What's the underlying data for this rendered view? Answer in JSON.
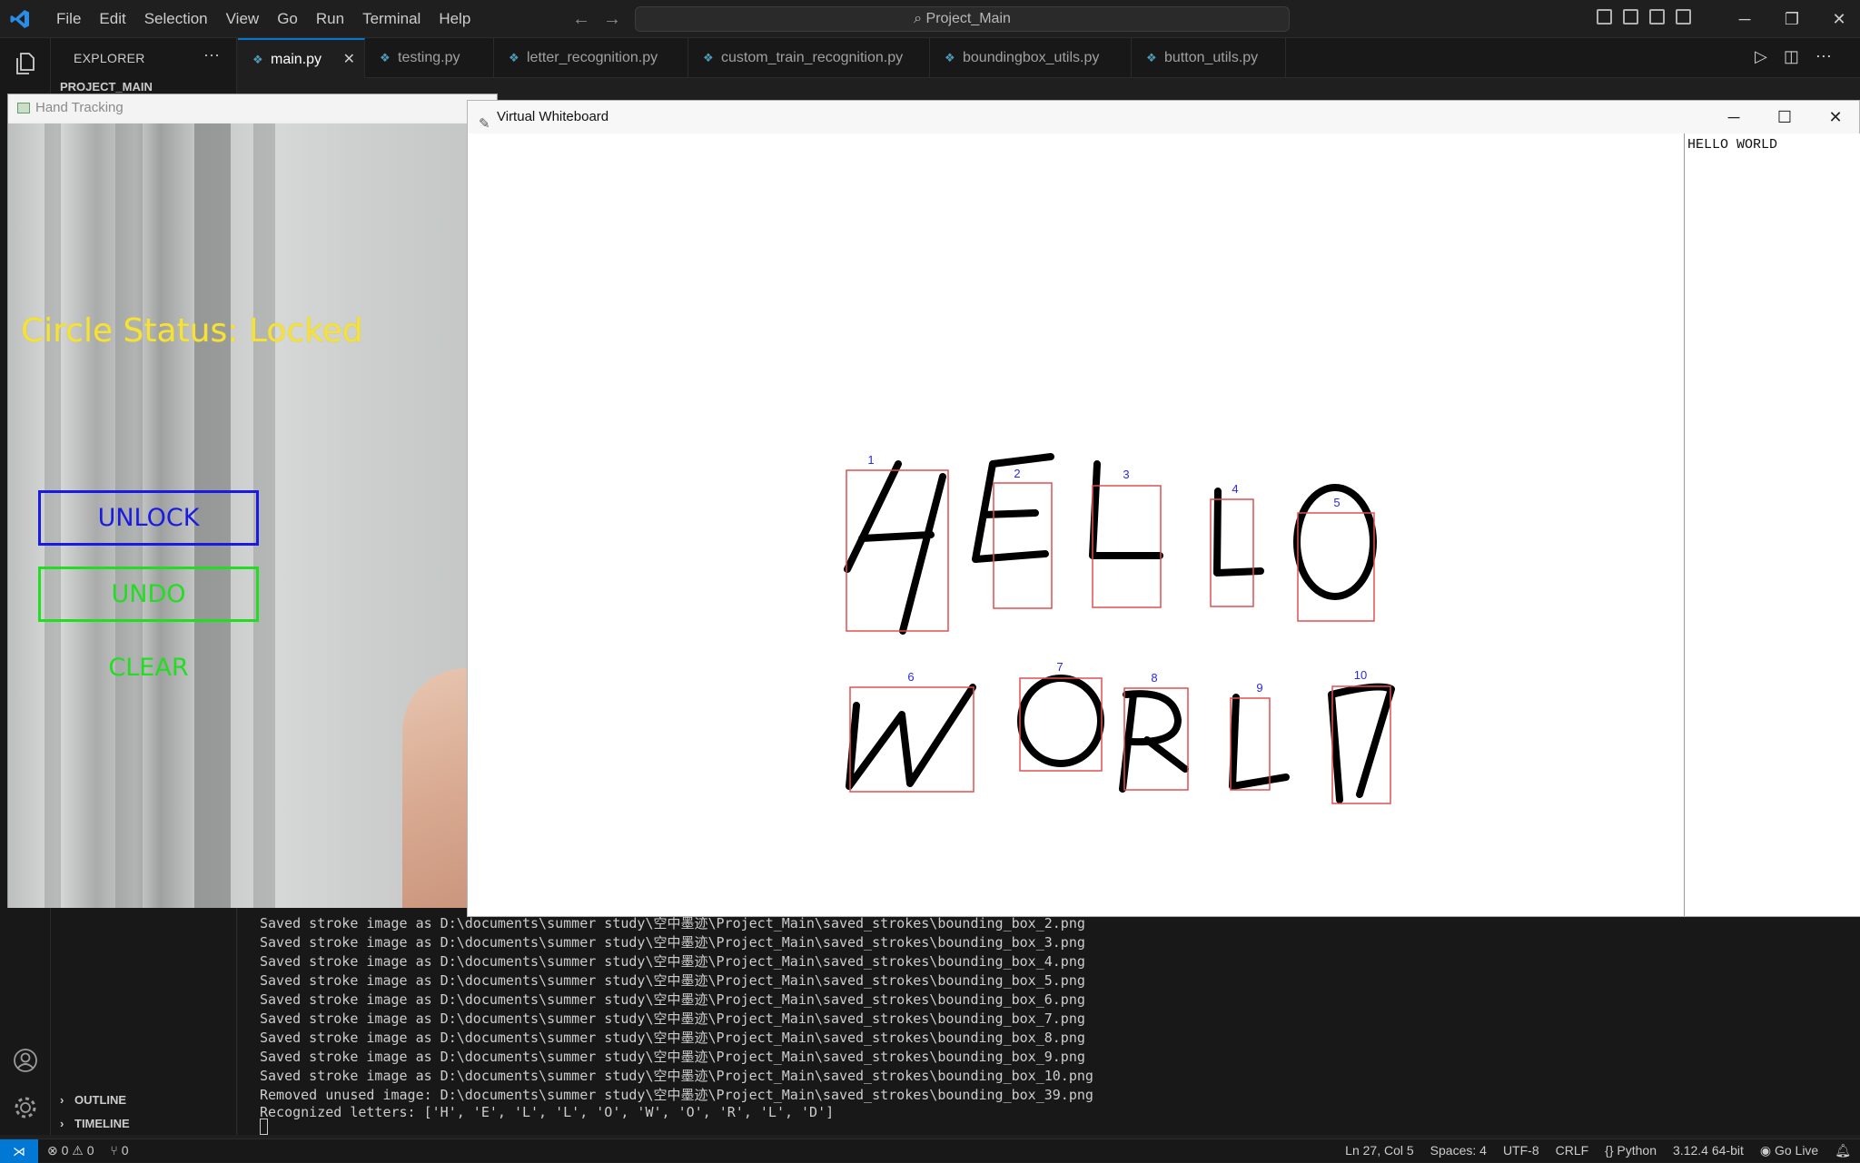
{
  "titlebar": {
    "menu": [
      "File",
      "Edit",
      "Selection",
      "View",
      "Go",
      "Run",
      "Terminal",
      "Help"
    ],
    "search": "Project_Main",
    "search_icon": "search-icon"
  },
  "sidebar": {
    "title": "EXPLORER",
    "more": "···",
    "project": "PROJECT_MAIN",
    "outline": "OUTLINE",
    "timeline": "TIMELINE"
  },
  "tabs": [
    "main.py",
    "testing.py",
    "letter_recognition.py",
    "custom_train_recognition.py",
    "boundingbox_utils.py",
    "button_utils.py"
  ],
  "hand_window": {
    "title": "Hand Tracking",
    "status": "Circle Status: Locked",
    "buttons": {
      "unlock": "UNLOCK",
      "undo": "UNDO",
      "clear": "CLEAR"
    },
    "colors": {
      "status": "#f5e13a",
      "unlock": "#1a1ae0",
      "undo": "#22dd22"
    }
  },
  "whiteboard": {
    "title": "Virtual Whiteboard",
    "recognized_text": "HELLO WORLD",
    "box_labels": [
      "1",
      "2",
      "3",
      "4",
      "5",
      "6",
      "7",
      "8",
      "9",
      "10"
    ],
    "box_color": "#e05050",
    "label_color": "#2a2ae0"
  },
  "terminal": {
    "lines": [
      "Saved stroke image as D:\\documents\\summer study\\空中墨迹\\Project_Main\\saved_strokes\\bounding_box_2.png",
      "Saved stroke image as D:\\documents\\summer study\\空中墨迹\\Project_Main\\saved_strokes\\bounding_box_3.png",
      "Saved stroke image as D:\\documents\\summer study\\空中墨迹\\Project_Main\\saved_strokes\\bounding_box_4.png",
      "Saved stroke image as D:\\documents\\summer study\\空中墨迹\\Project_Main\\saved_strokes\\bounding_box_5.png",
      "Saved stroke image as D:\\documents\\summer study\\空中墨迹\\Project_Main\\saved_strokes\\bounding_box_6.png",
      "Saved stroke image as D:\\documents\\summer study\\空中墨迹\\Project_Main\\saved_strokes\\bounding_box_7.png",
      "Saved stroke image as D:\\documents\\summer study\\空中墨迹\\Project_Main\\saved_strokes\\bounding_box_8.png",
      "Saved stroke image as D:\\documents\\summer study\\空中墨迹\\Project_Main\\saved_strokes\\bounding_box_9.png",
      "Saved stroke image as D:\\documents\\summer study\\空中墨迹\\Project_Main\\saved_strokes\\bounding_box_10.png",
      "Removed unused image: D:\\documents\\summer study\\空中墨迹\\Project_Main\\saved_strokes\\bounding_box_39.png",
      "Recognized letters: ['H', 'E', 'L', 'L', 'O', 'W', 'O', 'R', 'L', 'D']"
    ]
  },
  "statusbar": {
    "errors": "⊗ 0 ⚠ 0",
    "ports": "⑂ 0",
    "position": "Ln 27, Col 5",
    "spaces": "Spaces: 4",
    "encoding": "UTF-8",
    "eol": "CRLF",
    "language": "Python",
    "interpreter": "3.12.4 64-bit",
    "golive": "Go Live"
  }
}
